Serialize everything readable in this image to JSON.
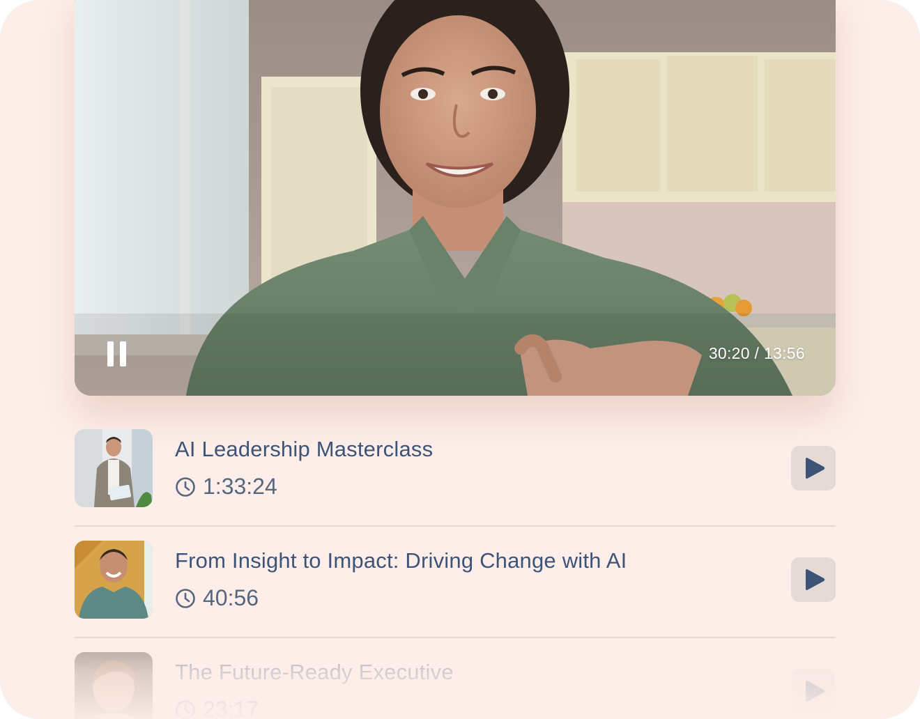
{
  "player": {
    "timecode": "30:20 / 13:56",
    "pause_icon": "pause-icon",
    "state": "playing"
  },
  "playlist": [
    {
      "title": "AI Leadership Masterclass",
      "duration": "1:33:24",
      "icon": "clock-icon",
      "action_icon": "play-icon"
    },
    {
      "title": "From Insight to Impact: Driving Change with AI",
      "duration": "40:56",
      "icon": "clock-icon",
      "action_icon": "play-icon"
    },
    {
      "title": "The Future-Ready Executive",
      "duration": "23:17",
      "icon": "clock-icon",
      "action_icon": "play-icon"
    }
  ],
  "colors": {
    "background": "#fdeee9",
    "title": "#3e5477",
    "duration": "#56667f",
    "play_button_bg": "#e6dad7",
    "play_icon": "#3e5477",
    "divider": "#e7d8d3"
  }
}
